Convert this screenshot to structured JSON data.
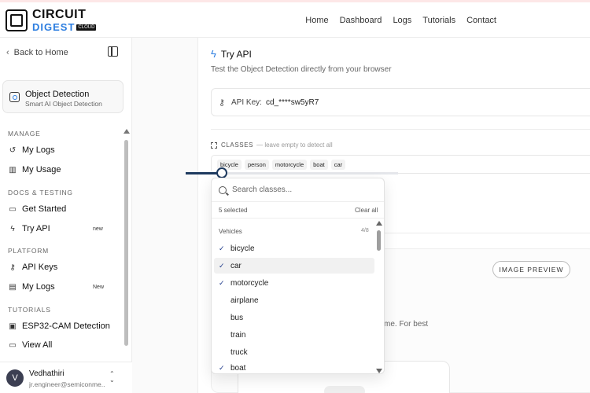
{
  "brand": {
    "line1": "CIRCUIT",
    "line2": "DIGEST",
    "tag": "CLOUD"
  },
  "nav": [
    "Home",
    "Dashboard",
    "Logs",
    "Tutorials",
    "Contact"
  ],
  "sidebar": {
    "back_label": "Back to Home",
    "service": {
      "title": "Object Detection",
      "subtitle": "Smart AI Object Detection"
    },
    "sections": {
      "manage": "MANAGE",
      "docs": "DOCS & TESTING",
      "platform": "PLATFORM",
      "tutorials": "TUTORIALS"
    },
    "items": [
      {
        "label": "My Logs",
        "icon": "history-icon"
      },
      {
        "label": "My Usage",
        "icon": "bar-chart-icon"
      },
      {
        "label": "Get Started",
        "icon": "book-icon"
      },
      {
        "label": "Try API",
        "icon": "bolt-icon",
        "badge": "new"
      },
      {
        "label": "API Keys",
        "icon": "key-icon"
      },
      {
        "label": "My Logs",
        "icon": "message-icon",
        "badge": "New"
      },
      {
        "label": "ESP32-CAM Detection",
        "icon": "chip-icon"
      },
      {
        "label": "View All",
        "icon": "book-icon"
      }
    ],
    "user": {
      "initial": "V",
      "name": "Vedhathiri",
      "email": "jr.engineer@semiconme..."
    }
  },
  "main": {
    "title": "Try API",
    "subtitle": "Test the Object Detection directly from your browser",
    "api_key_label": "API Key:",
    "api_key_value": "cd_****sw5yR7",
    "classes_label": "CLASSES",
    "classes_hint": "— leave empty to detect all",
    "chips": [
      "bicycle",
      "person",
      "motorcycle",
      "boat",
      "car"
    ],
    "confidence_fraction": 0.17,
    "preview_button": "IMAGE PREVIEW",
    "partial_text": "me. For best"
  },
  "dropdown": {
    "search_placeholder": "Search classes...",
    "selected_text": "5 selected",
    "clear_label": "Clear all",
    "group": "Vehicles",
    "group_count": "4/8",
    "check_char": "✓",
    "items": [
      {
        "label": "bicycle",
        "checked": true
      },
      {
        "label": "car",
        "checked": true
      },
      {
        "label": "motorcycle",
        "checked": true
      },
      {
        "label": "airplane",
        "checked": false
      },
      {
        "label": "bus",
        "checked": false
      },
      {
        "label": "train",
        "checked": false
      },
      {
        "label": "truck",
        "checked": false
      },
      {
        "label": "boat",
        "checked": true
      }
    ]
  },
  "colors": {
    "accent": "#2d7ee0",
    "slider": "#1e3a5f",
    "check": "#1e3a8a"
  }
}
